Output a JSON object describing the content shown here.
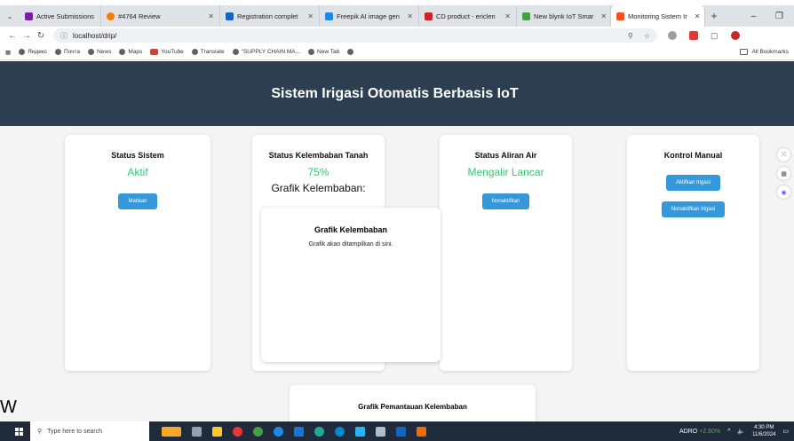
{
  "browser": {
    "tabs": [
      {
        "label": "Active Submissions",
        "color": "#7b1fa2"
      },
      {
        "label": "#4764 Review",
        "color": "#f57c00"
      },
      {
        "label": "Registration complet",
        "color": "#1565c0"
      },
      {
        "label": "Freepik AI image gen",
        "color": "#1e88e5"
      },
      {
        "label": "CD product - ericlen",
        "color": "#c62828"
      },
      {
        "label": "New blynk IoT Smar",
        "color": "#43a047"
      },
      {
        "label": "Monitoring Sistem Ir",
        "color": "#f4511e"
      }
    ],
    "url": "localhost/drip/",
    "bookmarks": [
      "Яндекс",
      "Почта",
      "News",
      "Maps",
      "YouTube",
      "Translate",
      "\"SUPPLY CHAIN MA...",
      "New Tab"
    ],
    "all_bookmarks": "All Bookmarks"
  },
  "page": {
    "title": "Sistem Irigasi Otomatis Berbasis IoT",
    "status_sistem": {
      "title": "Status Sistem",
      "status": "Aktif",
      "button": "Matikan"
    },
    "kelembaban": {
      "title": "Status Kelembaban Tanah",
      "value": "75%",
      "grafik_label": "Grafik Kelembaban:"
    },
    "aliran": {
      "title": "Status Aliran Air",
      "status": "Mengalir Lancar",
      "button": "Nonaktifkan"
    },
    "kontrol": {
      "title": "Kontrol Manual",
      "btn_on": "Aktifkan Irigasi",
      "btn_off": "Nonaktifkan Irigasi"
    },
    "popup": {
      "title": "Grafik Kelembaban",
      "text": "Grafik akan ditampilkan di sini."
    },
    "pemantauan": {
      "title": "Grafik Pemantauan Kelembaban"
    }
  },
  "taskbar": {
    "search_placeholder": "Type here to search",
    "stock": "ADRO",
    "stock_change": "+2.80%",
    "time": "4:30 PM",
    "date": "11/6/2024",
    "w_letter": "W"
  },
  "colors": {
    "header": "#2c3e50",
    "accent": "#3498db",
    "ok": "#2ecc71"
  }
}
